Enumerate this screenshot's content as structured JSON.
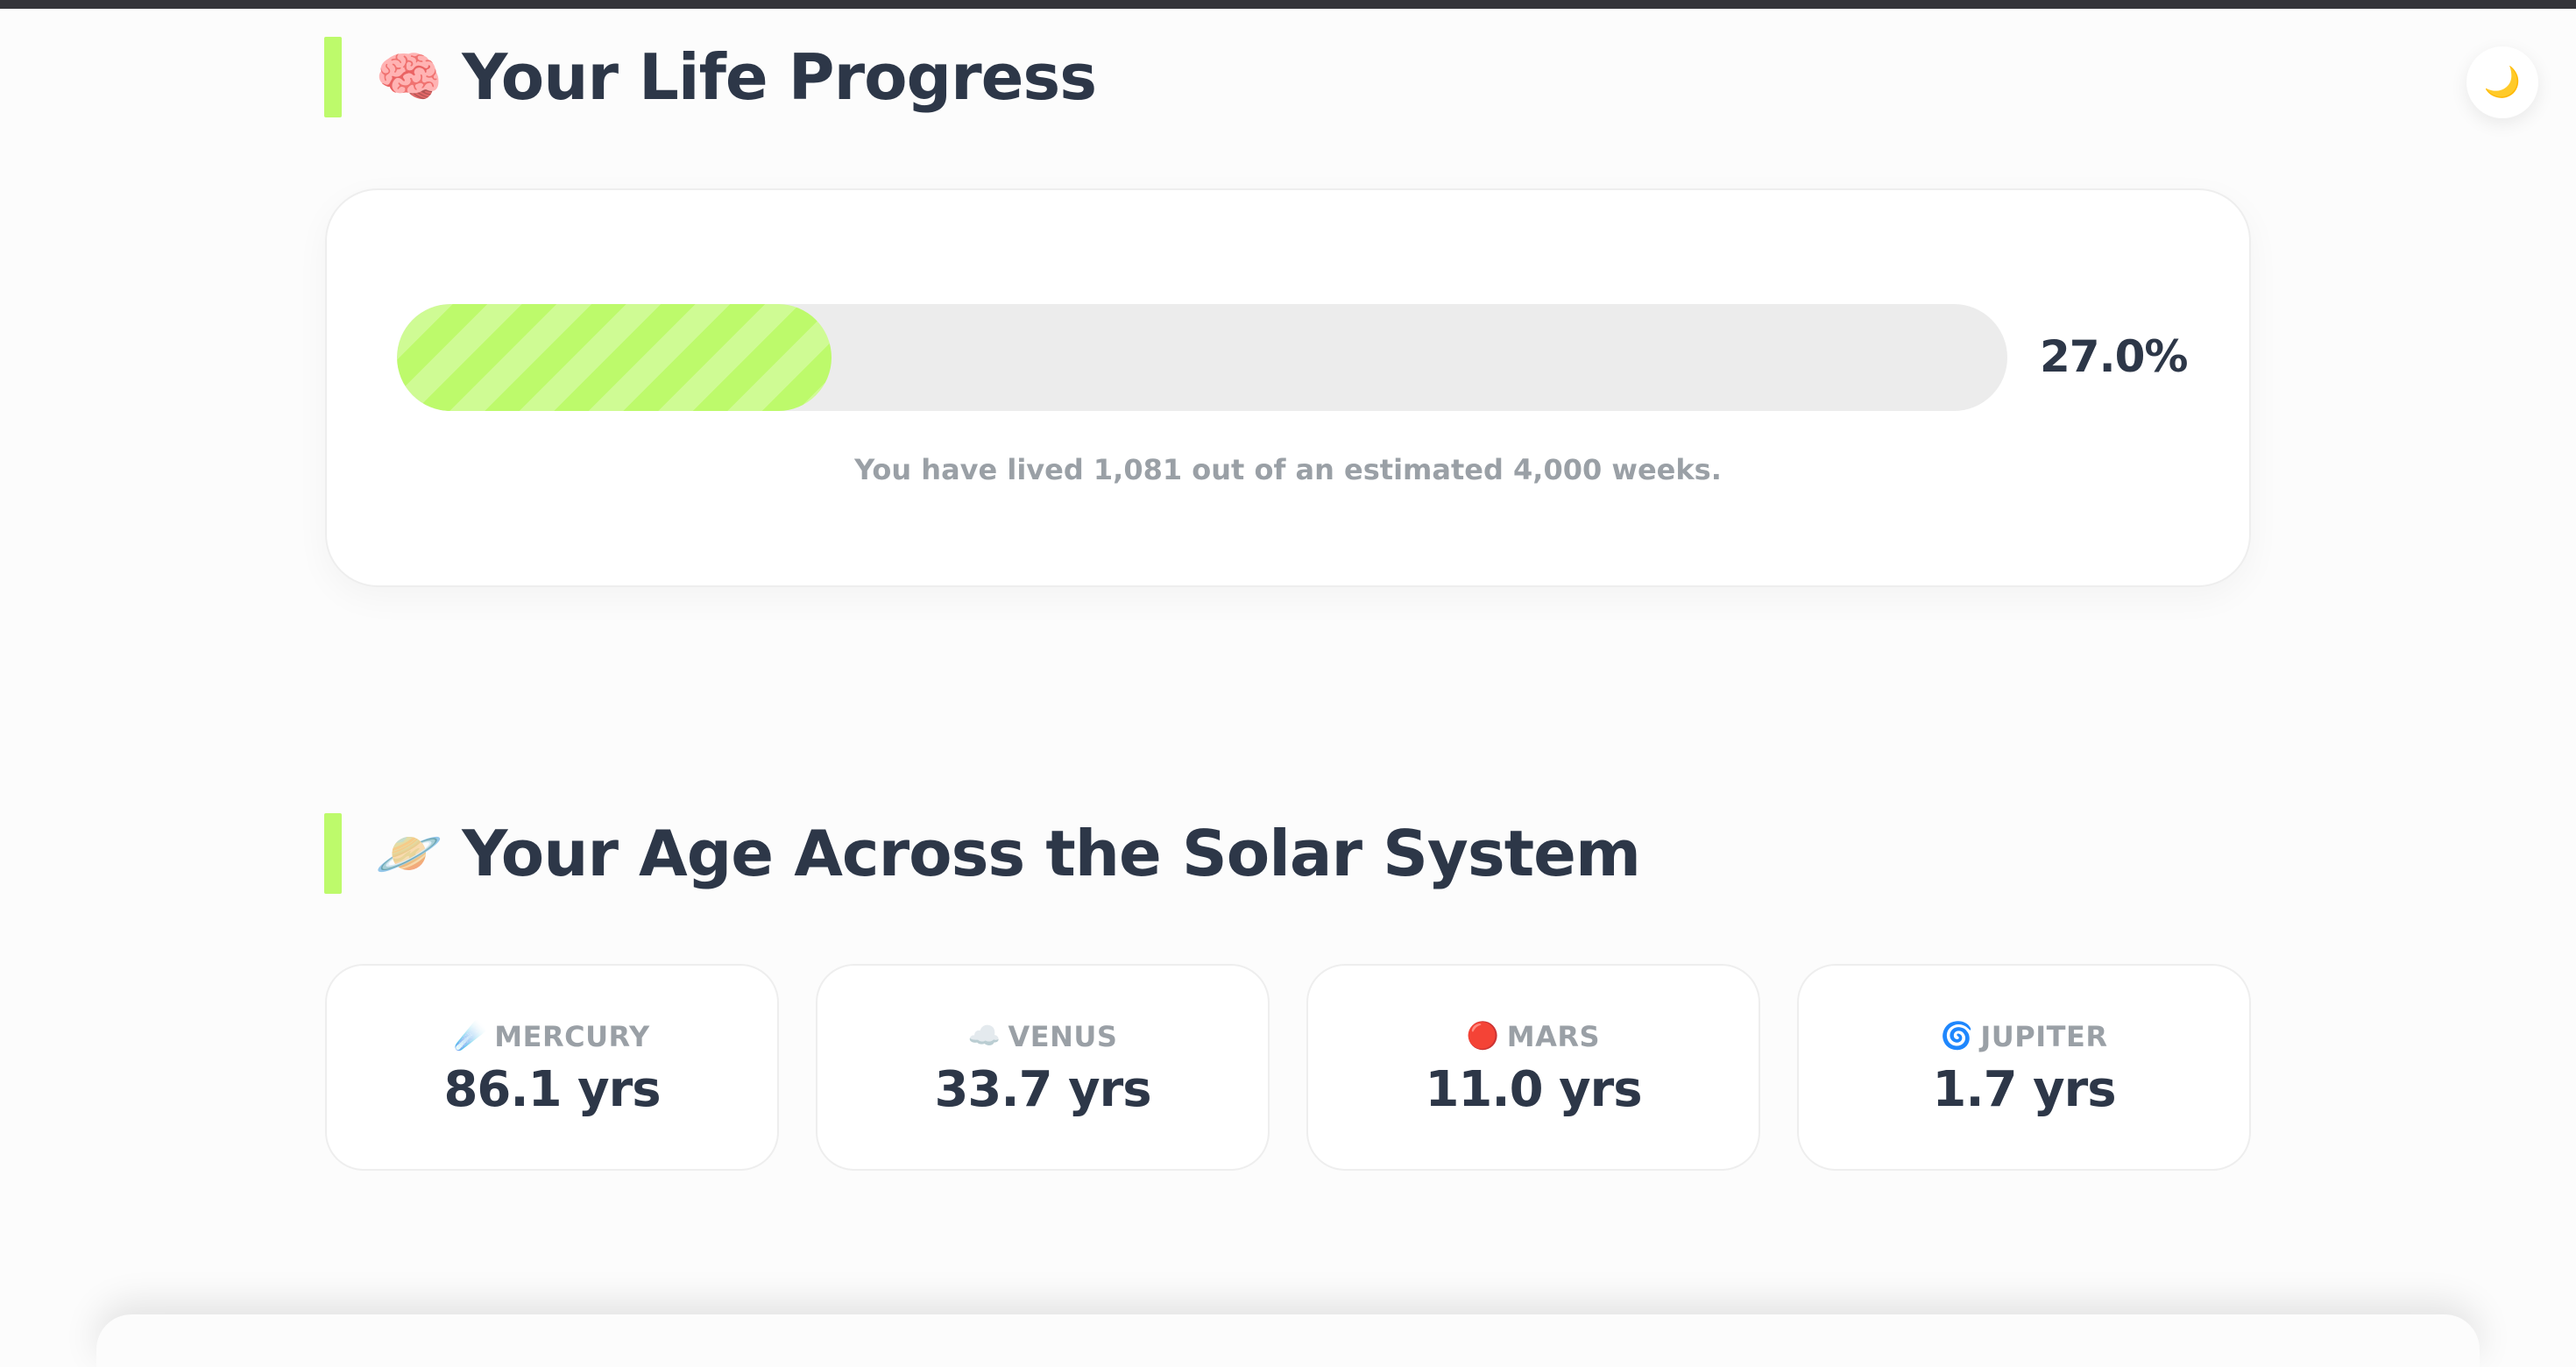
{
  "theme_toggle": {
    "icon": "moon-icon",
    "glyph": "🌙"
  },
  "life_progress": {
    "emoji": "🧠",
    "icon": "brain-icon",
    "title": "Your Life Progress",
    "percent": 27.0,
    "percent_label": "27.0%",
    "caption": "You have lived 1,081 out of an estimated 4,000 weeks.",
    "fill_color": "#bdfa6b"
  },
  "solar_system": {
    "emoji": "🪐",
    "icon": "ringed-planet-icon",
    "title": "Your Age Across the Solar System",
    "planets": [
      {
        "icon": "comet-icon",
        "glyph": "☄️",
        "name": "MERCURY",
        "value": "86.1 yrs"
      },
      {
        "icon": "cloud-icon",
        "glyph": "☁️",
        "name": "VENUS",
        "value": "33.7 yrs"
      },
      {
        "icon": "red-circle-icon",
        "glyph": "🔴",
        "name": "MARS",
        "value": "11.0 yrs"
      },
      {
        "icon": "cyclone-icon",
        "glyph": "🌀",
        "name": "JUPITER",
        "value": "1.7 yrs"
      }
    ]
  },
  "colors": {
    "accent": "#bdfa6b",
    "heading": "#2d3748",
    "muted": "#9aa0a6",
    "track": "#ececec"
  }
}
